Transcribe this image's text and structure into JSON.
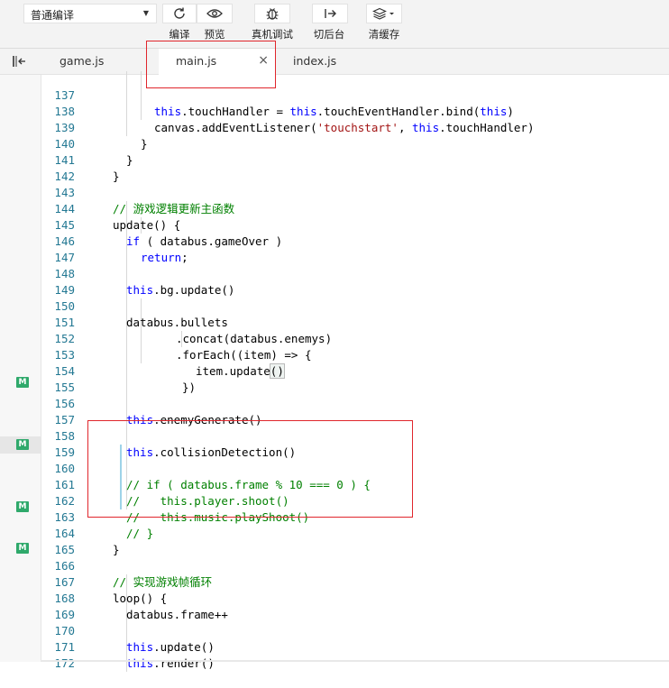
{
  "toolbar": {
    "mode_select": "普通编译",
    "buttons": [
      {
        "label": "编译",
        "icon": "refresh-icon"
      },
      {
        "label": "预览",
        "icon": "eye-icon"
      },
      {
        "label": "真机调试",
        "icon": "bug-icon"
      },
      {
        "label": "切后台",
        "icon": "switch-background-icon"
      },
      {
        "label": "清缓存",
        "icon": "layers-icon"
      }
    ]
  },
  "tabs": [
    {
      "label": "game.js",
      "active": false
    },
    {
      "label": "main.js",
      "active": true,
      "close": "×"
    },
    {
      "label": "index.js",
      "active": false
    }
  ],
  "git_badge": "M",
  "editor": {
    "lines": [
      {
        "n": "137"
      },
      {
        "n": "138"
      },
      {
        "n": "139",
        "t": "}"
      },
      {
        "n": "140",
        "t": "}"
      },
      {
        "n": "141",
        "t": "}"
      },
      {
        "n": "142",
        "t": ""
      },
      {
        "n": "143",
        "t": "// 游戏逻辑更新主函数"
      },
      {
        "n": "144",
        "t": "update() {"
      },
      {
        "n": "145"
      },
      {
        "n": "146"
      },
      {
        "n": "147",
        "t": ""
      },
      {
        "n": "148"
      },
      {
        "n": "149",
        "t": ""
      },
      {
        "n": "150",
        "t": "databus.bullets"
      },
      {
        "n": "151",
        "t": ".concat(databus.enemys)"
      },
      {
        "n": "152",
        "t": ".forEach((item) => {"
      },
      {
        "n": "153",
        "t": "item.update()"
      },
      {
        "n": "154",
        "t": "})"
      },
      {
        "n": "155",
        "t": ""
      },
      {
        "n": "156"
      },
      {
        "n": "157",
        "t": ""
      },
      {
        "n": "158"
      },
      {
        "n": "159",
        "t": ""
      },
      {
        "n": "160",
        "t": "// if ( databus.frame % 10 === 0 ) {"
      },
      {
        "n": "161",
        "t": "//   this.player.shoot()"
      },
      {
        "n": "162",
        "t": "//   this.music.playShoot()"
      },
      {
        "n": "163",
        "t": "// }"
      },
      {
        "n": "164",
        "t": "}"
      },
      {
        "n": "165",
        "t": ""
      },
      {
        "n": "166",
        "t": "// 实现游戏帧循环"
      },
      {
        "n": "167",
        "t": "loop() {"
      },
      {
        "n": "168",
        "t": "databus.frame++"
      },
      {
        "n": "169",
        "t": ""
      },
      {
        "n": "170"
      },
      {
        "n": "171"
      },
      {
        "n": "172",
        "t": ""
      }
    ],
    "tokens": {
      "this": "this",
      "l137_a": ".touchHandler = ",
      "l137_b": ".touchEventHandler.bind(",
      "l137_c": ")",
      "l138_a": "canvas.addEventListener(",
      "l138_str": "'touchstart'",
      "l138_b": ", ",
      "l138_c": ".touchHandler)",
      "if_kw": "if",
      "l145_rest": " ( databus.gameOver )",
      "return_kw": "return",
      "l146_rest": ";",
      "l148_rest": ".bg.update()",
      "l156_rest": ".enemyGenerate()",
      "l158_rest": ".collisionDetection()",
      "l170_rest": ".update()",
      "l171_rest": ".render()"
    }
  },
  "colors": {
    "keyword": "#0000ff",
    "string": "#a31515",
    "comment": "#008000",
    "line_number": "#237893",
    "git_modified": "#2fa96b",
    "annotation": "#e0262c"
  }
}
